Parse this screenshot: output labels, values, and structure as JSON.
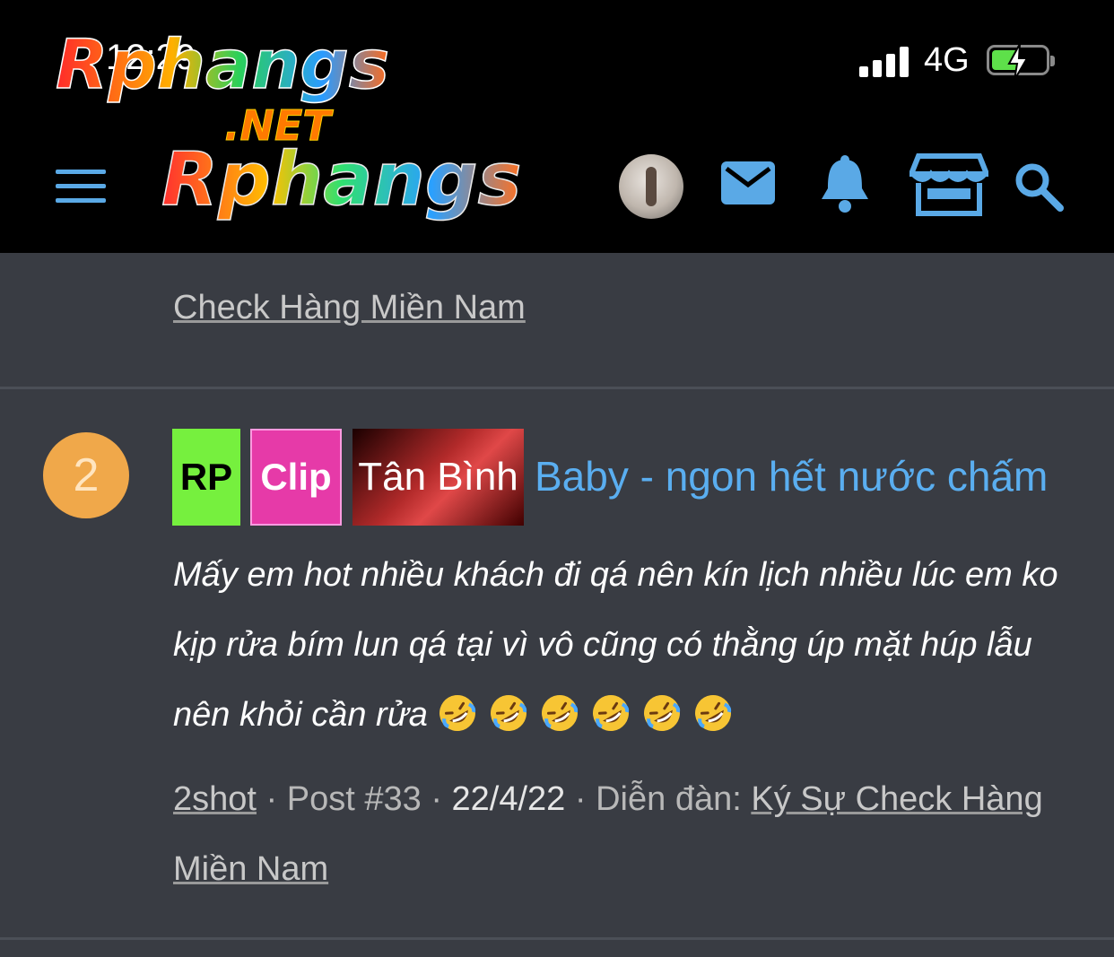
{
  "status_bar": {
    "time": "12:29",
    "network": "4G",
    "battery_charge": 0.45
  },
  "watermark": {
    "logo_text": "Rphangs",
    "logo_suffix": ".NET"
  },
  "header": {
    "site_logo_text": "Rphangs",
    "icons": [
      "menu-icon",
      "avatar",
      "mail-icon",
      "bell-icon",
      "store-icon",
      "search-icon"
    ],
    "accent_color": "#5aa9e6"
  },
  "previous_result": {
    "forum_link": "Check Hàng Miền Nam"
  },
  "result": {
    "rank": "2",
    "tags": [
      "RP",
      "Clip",
      "Tân Bình"
    ],
    "title": "Baby - ngon hết nước chấm",
    "snippet": "Mấy em hot nhiều khách đi qá nên kín lịch nhiều lúc em ko kịp rửa bím lun qá tại vì vô cũng có thằng úp mặt húp lẫu nên khỏi cần rửa",
    "emoji": [
      "rolling-on-floor-laughing",
      "rolling-on-floor-laughing",
      "rolling-on-floor-laughing",
      "rolling-on-floor-laughing",
      "rolling-on-floor-laughing",
      "rolling-on-floor-laughing"
    ],
    "author": "2shot",
    "post_label": "Post #33",
    "date": "22/4/22",
    "forum_label": "Diễn đàn:",
    "forum_name": "Ký Sự Check Hàng Miền Nam",
    "separator": "·"
  }
}
